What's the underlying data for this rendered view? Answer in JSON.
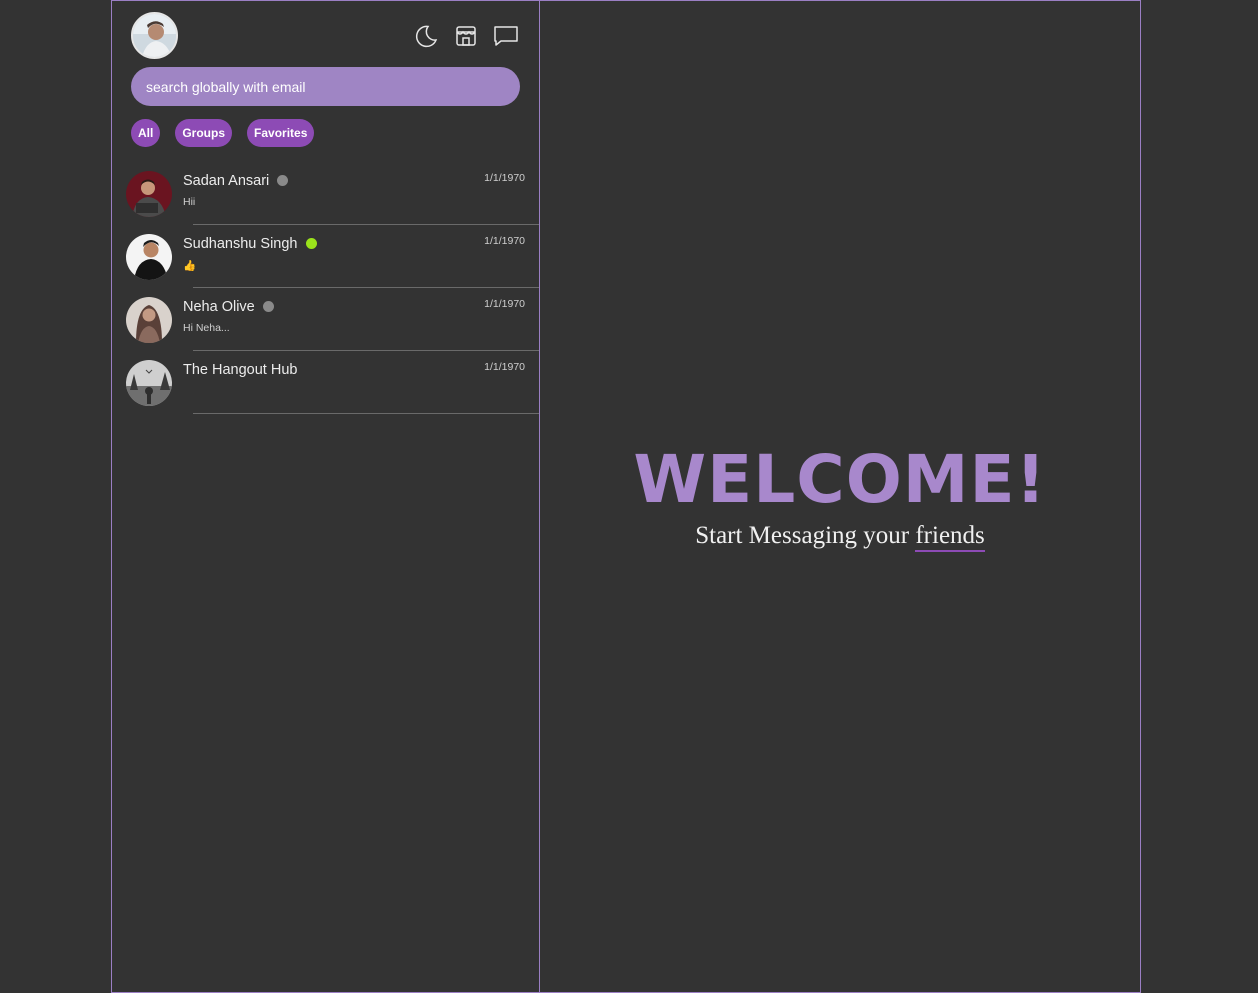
{
  "header": {
    "icons": [
      "moon-icon",
      "store-icon",
      "chat-bubble-icon"
    ]
  },
  "search": {
    "placeholder": "search globally with email"
  },
  "filters": [
    {
      "label": "All"
    },
    {
      "label": "Groups"
    },
    {
      "label": "Favorites"
    }
  ],
  "chats": [
    {
      "name": "Sadan Ansari",
      "preview": "Hii",
      "time": "1/1/1970",
      "status": "offline",
      "status_color": "#8a8a8a"
    },
    {
      "name": "Sudhanshu Singh",
      "preview": "👍",
      "time": "1/1/1970",
      "status": "online",
      "status_color": "#9be31b"
    },
    {
      "name": "Neha Olive",
      "preview": "Hi Neha...",
      "time": "1/1/1970",
      "status": "offline",
      "status_color": "#8a8a8a"
    },
    {
      "name": "The Hangout Hub",
      "preview": "",
      "time": "1/1/1970",
      "status": "none"
    }
  ],
  "welcome": {
    "title": "WELCOME!",
    "subtitle_start": "Start Messaging your ",
    "subtitle_highlight": "friends"
  },
  "colors": {
    "background": "#333333",
    "accent": "#8d4bb5",
    "search_bg": "#9f85c4",
    "border": "#9b7fc4"
  }
}
